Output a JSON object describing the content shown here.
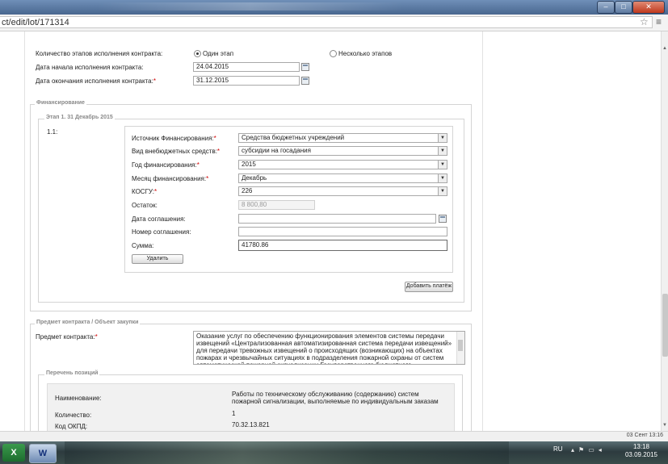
{
  "browser": {
    "url": "ct/edit/lot/171314"
  },
  "contract": {
    "stages_label": "Количество этапов исполнения контракта:",
    "stages_option_one": "Один этап",
    "stages_option_many": "Несколько этапов",
    "start_label": "Дата начала исполнения контракта:",
    "start_value": "24.04.2015",
    "end_label": "Дата окончания исполнения контракта:",
    "end_value": "31.12.2015"
  },
  "financing": {
    "legend": "Финансирование",
    "stage_legend": "Этап 1. 31 Декабрь 2015",
    "item_number": "1.1:",
    "source_label": "Источник Финансирования:",
    "source_value": "Средства бюджетных учреждений",
    "offbudget_label": "Вид внебюджетных средств:",
    "offbudget_value": "субсидии на госадания",
    "year_label": "Год финансирования:",
    "year_value": "2015",
    "month_label": "Месяц финансирования:",
    "month_value": "Декабрь",
    "kosgu_label": "КОСГУ:",
    "kosgu_value": "226",
    "remainder_label": "Остаток:",
    "remainder_value": "8 800,80",
    "agreement_date_label": "Дата соглашения:",
    "agreement_date_value": "",
    "agreement_number_label": "Номер соглашения:",
    "agreement_number_value": "",
    "sum_label": "Сумма:",
    "sum_value": "41780.86",
    "delete_button": "Удалить",
    "add_payment_button": "Добавить платёж"
  },
  "subject": {
    "legend": "Предмет контракта / Объект закупки",
    "label": "Предмет контракта:",
    "value": "Оказание услуг по обеспечению функционирования элементов системы передачи извещений «Централизованная автоматизированная система передачи извещений» для передачи тревожных извещений о происходящих (возникающих) на объектах пожарах и чрезвычайных ситуациях в подразделения пожарной охраны от систем автоматической пожарной сигнализации Государственного бюджетного"
  },
  "positions": {
    "legend": "Перечень позиций",
    "name_label": "Наименование:",
    "name_value": "Работы по техническому обслуживанию (содержанию) систем пожарной сигнализации, выполняемые по индивидуальным заказам",
    "quantity_label": "Количество:",
    "quantity_value": "1",
    "okpd_label": "Код ОКПД:",
    "okpd_value": "70.32.13.821"
  },
  "statusbar": {
    "date": "03 Сент 13:16"
  },
  "taskbar": {
    "language": "RU",
    "time": "13:18",
    "date": "03.09.2015"
  },
  "icons": {
    "star": "star-icon",
    "menu": "menu-icon",
    "calendar": "calendar-icon",
    "dropdown": "chevron-down-icon",
    "excel": "excel-icon",
    "word": "word-icon"
  }
}
